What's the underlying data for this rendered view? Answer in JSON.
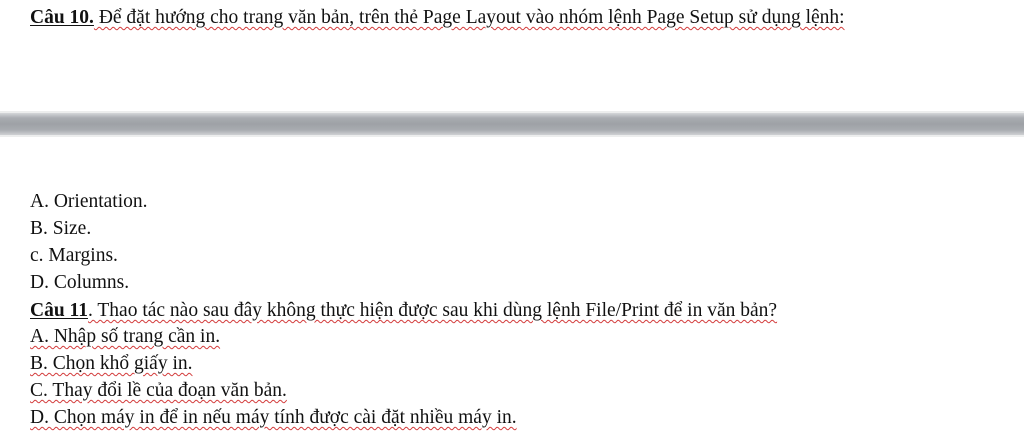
{
  "question10": {
    "title": "Câu 10.",
    "text": " Để đặt hướng cho trang văn bản, trên thẻ Page Layout vào nhóm lệnh Page Setup sử dụng lệnh:",
    "options": [
      "A. Orientation.",
      "B. Size.",
      "c. Margins.",
      "D. Columns."
    ]
  },
  "question11": {
    "title": "Câu 11",
    "text": ". Thao tác nào sau đây không thực hiện được sau khi dùng lệnh File/Print để in văn bản?",
    "options": [
      "A. Nhập số trang cần in.",
      "B. Chọn khổ giấy in.",
      "C. Thay đổi lề của đoạn văn bản.",
      "D. Chọn máy in để in nếu máy tính được cài đặt nhiều máy in."
    ]
  }
}
